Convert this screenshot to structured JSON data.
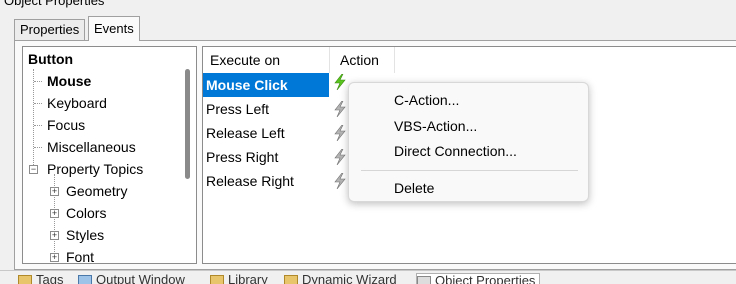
{
  "window": {
    "title": "Object Properties"
  },
  "tabs": [
    {
      "label": "Properties",
      "active": false
    },
    {
      "label": "Events",
      "active": true
    }
  ],
  "tree": {
    "items": [
      {
        "label": "Button",
        "bold": true
      },
      {
        "label": "Mouse",
        "bold": true,
        "selected": true
      },
      {
        "label": "Keyboard"
      },
      {
        "label": "Focus"
      },
      {
        "label": "Miscellaneous"
      },
      {
        "label": "Property Topics",
        "expander": "minus"
      },
      {
        "label": "Geometry",
        "expander": "plus"
      },
      {
        "label": "Colors",
        "expander": "plus"
      },
      {
        "label": "Styles",
        "expander": "plus"
      },
      {
        "label": "Font",
        "expander": "plus"
      }
    ]
  },
  "events_table": {
    "columns": [
      "Execute on",
      "Action"
    ],
    "rows": [
      {
        "event": "Mouse Click",
        "selected": true,
        "icon": "lightning-green-icon"
      },
      {
        "event": "Press Left",
        "icon": "lightning-gray-icon"
      },
      {
        "event": "Release Left",
        "icon": "lightning-gray-icon"
      },
      {
        "event": "Press Right",
        "icon": "lightning-gray-icon"
      },
      {
        "event": "Release Right",
        "icon": "lightning-gray-icon"
      }
    ]
  },
  "context_menu": {
    "items": [
      "C-Action...",
      "VBS-Action...",
      "Direct Connection...",
      "Delete"
    ]
  },
  "taskbar": {
    "items": [
      "Tags",
      "Output Window",
      "Library",
      "Dynamic Wizard",
      "Object Properties"
    ]
  },
  "colors": {
    "selection": "#0078d7",
    "active_bolt": "#5ac51e",
    "inactive_bolt": "#8a8a8a"
  }
}
